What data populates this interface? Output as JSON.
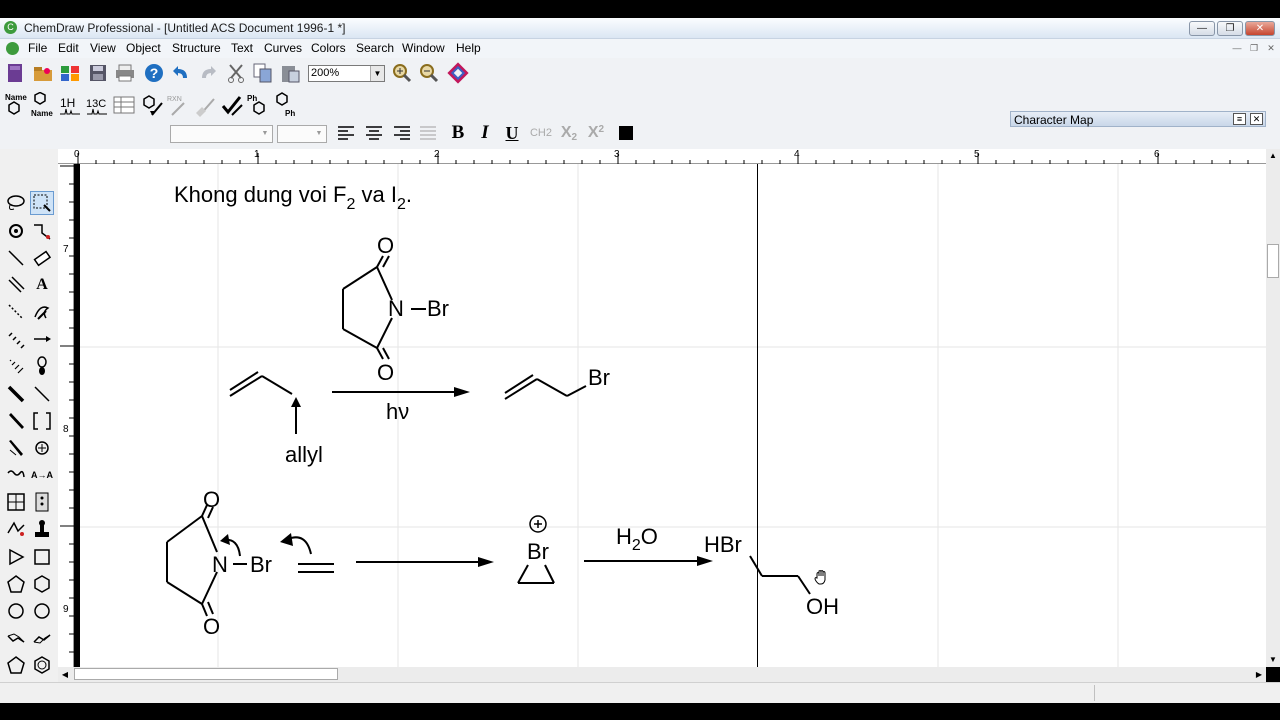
{
  "window": {
    "title": "ChemDraw Professional - [Untitled ACS Document 1996-1 *]",
    "app_icon_glyph": "C"
  },
  "menu": [
    "File",
    "Edit",
    "View",
    "Object",
    "Structure",
    "Text",
    "Curves",
    "Colors",
    "Search",
    "Window",
    "Help"
  ],
  "toolbar": {
    "zoom_value": "200%",
    "name_struct_label": "Name",
    "struct_name_label": "Name",
    "h_nmr_label": "1H",
    "c_nmr_label": "13C",
    "rxn_label": "RXN",
    "ph_label": "Ph",
    "bold_label": "B",
    "italic_label": "I",
    "underline_label": "U",
    "ch2_label": "CH2",
    "subscript_label": "X",
    "superscript_label": "X"
  },
  "character_map": {
    "title": "Character Map"
  },
  "ruler": {
    "horizontal_labels": [
      "0",
      "1",
      "2",
      "3",
      "4",
      "5",
      "6"
    ],
    "vertical_labels": [
      "7",
      "8",
      "9"
    ]
  },
  "palette": {
    "text_tool_label": "A",
    "arrow_label": "A→A"
  },
  "document": {
    "heading_prefix": "Khong dung voi F",
    "heading_sub1": "2",
    "heading_mid": " va I",
    "heading_sub2": "2",
    "heading_suffix": ".",
    "nbs_o_top": "O",
    "nbs_o_bottom": "O",
    "nbs_n": "N",
    "nbs_br": "Br",
    "reaction1_condition": "hν",
    "product1_br": "Br",
    "allyl_label": "allyl",
    "nbs2_o_top": "O",
    "nbs2_o_bottom": "O",
    "nbs2_n": "N",
    "nbs2_br": "Br",
    "bromonium_br": "Br",
    "bromonium_charge": "+",
    "reaction2_reagent_h": "H",
    "reaction2_reagent_sub": "2",
    "reaction2_reagent_o": "O",
    "product2_hbr": "HBr",
    "product2_oh": "OH"
  }
}
